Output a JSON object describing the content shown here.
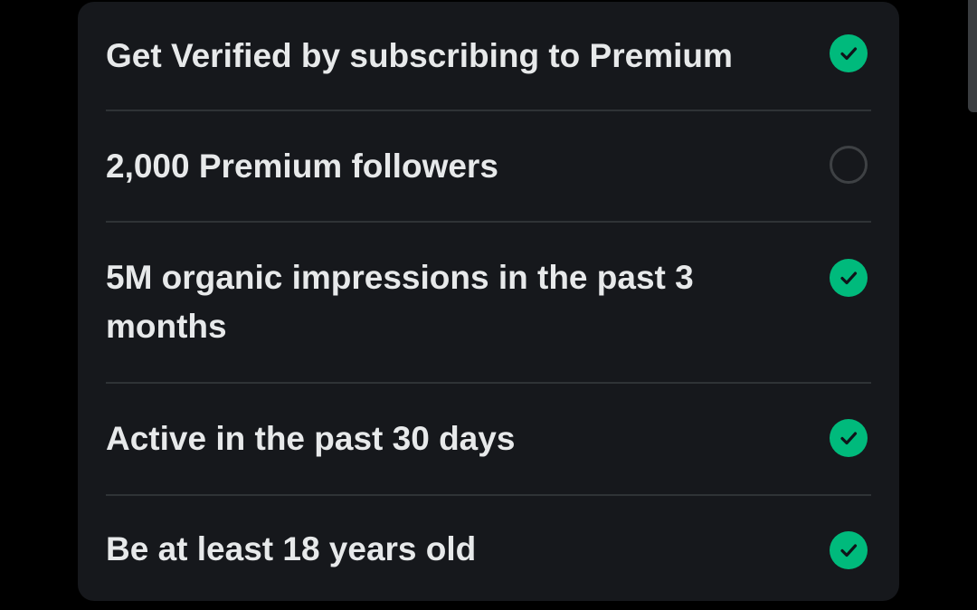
{
  "requirements": [
    {
      "label": "Get Verified by subscribing to Premium",
      "met": true,
      "status_icon": "checkmark-icon"
    },
    {
      "label": "2,000 Premium followers",
      "met": false,
      "status_icon": "empty-circle-icon"
    },
    {
      "label": "5M organic impressions in the past 3 months",
      "met": true,
      "status_icon": "checkmark-icon"
    },
    {
      "label": "Active in the past 30 days",
      "met": true,
      "status_icon": "checkmark-icon"
    },
    {
      "label": "Be at least 18 years old",
      "met": true,
      "status_icon": "checkmark-icon"
    }
  ],
  "colors": {
    "card_background": "#16181c",
    "text": "#e7e9ea",
    "divider": "#2f3336",
    "met_green": "#00ba7c",
    "unmet_ring": "#3e4144"
  }
}
